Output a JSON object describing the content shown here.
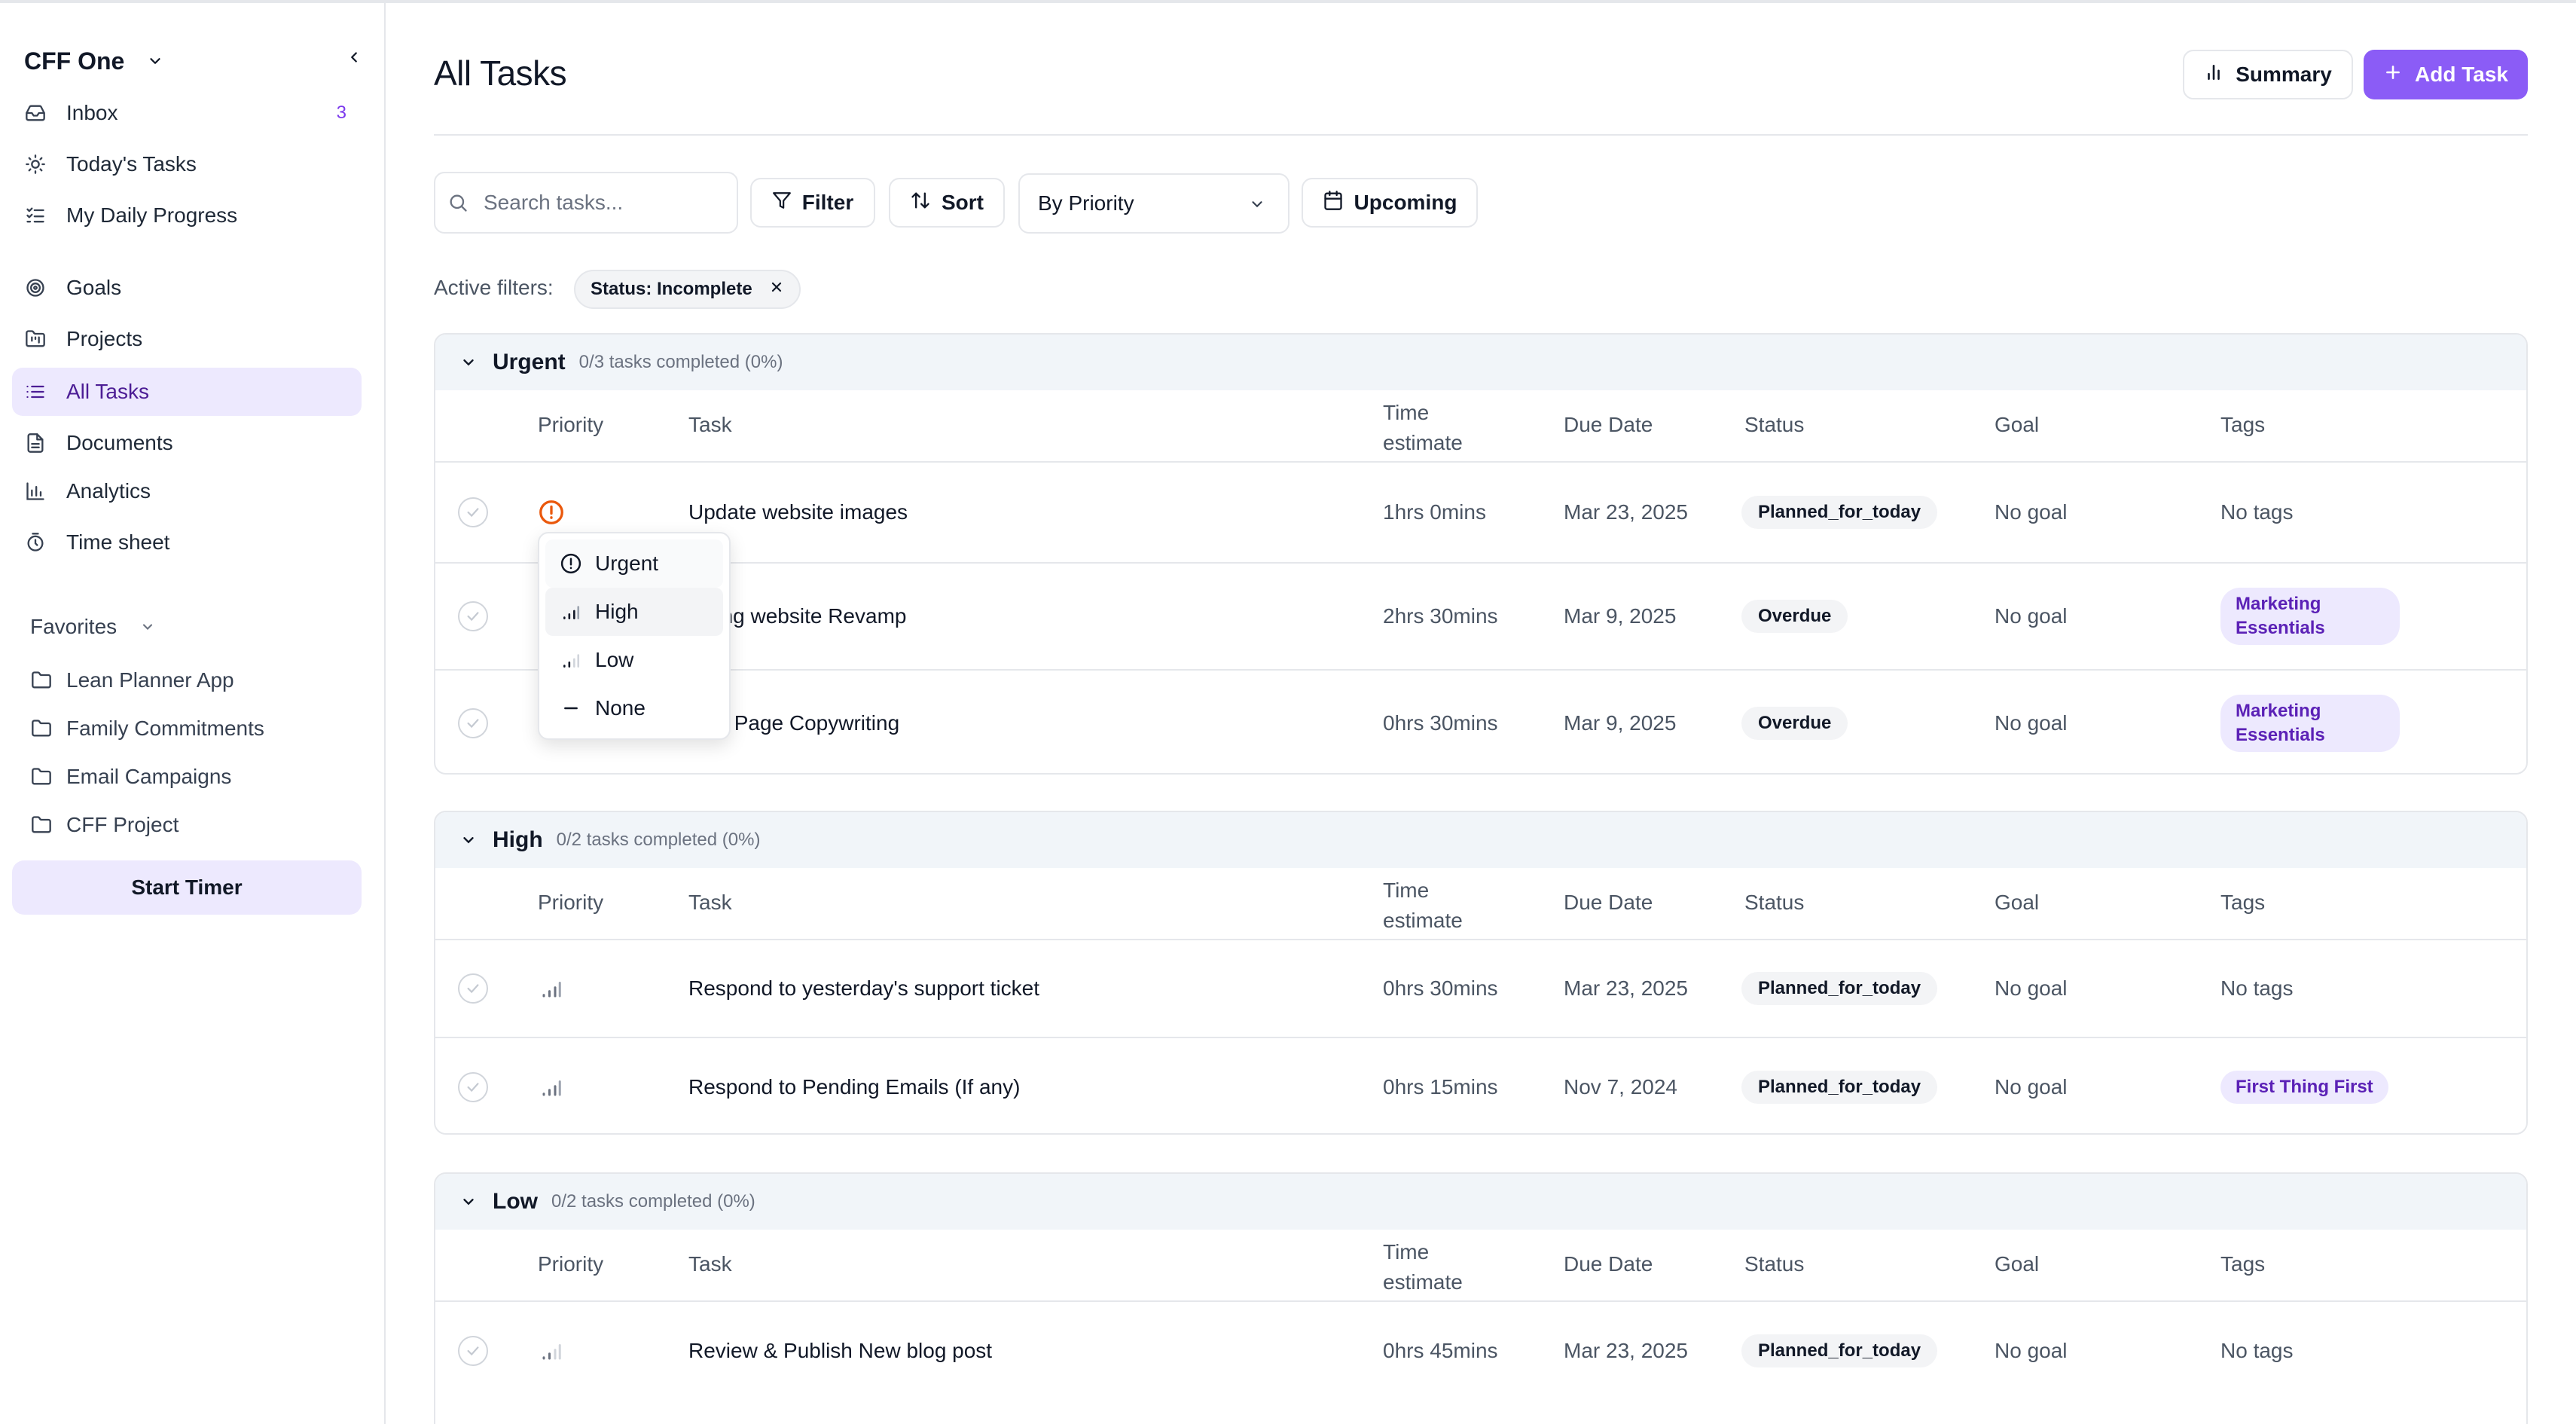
{
  "sidebar": {
    "workspace": "CFF One",
    "nav": [
      {
        "label": "Inbox",
        "icon": "inbox-icon",
        "count": "3"
      },
      {
        "label": "Today's Tasks",
        "icon": "sun-icon"
      },
      {
        "label": "My Daily Progress",
        "icon": "list-check-icon"
      },
      {
        "label": "Goals",
        "icon": "target-icon"
      },
      {
        "label": "Projects",
        "icon": "folder-kanban-icon"
      },
      {
        "label": "All Tasks",
        "icon": "list-icon",
        "active": true
      },
      {
        "label": "Documents",
        "icon": "document-icon"
      },
      {
        "label": "Analytics",
        "icon": "bar-chart-icon"
      },
      {
        "label": "Time sheet",
        "icon": "timer-icon"
      }
    ],
    "favorites_label": "Favorites",
    "favorites": [
      {
        "label": "Lean Planner App"
      },
      {
        "label": "Family Commitments"
      },
      {
        "label": "Email Campaigns"
      },
      {
        "label": "CFF Project"
      }
    ],
    "start_timer": "Start Timer"
  },
  "header": {
    "title": "All Tasks",
    "summary_label": "Summary",
    "add_task_label": "Add Task"
  },
  "toolbar": {
    "search_placeholder": "Search tasks...",
    "filter_label": "Filter",
    "sort_label": "Sort",
    "group_by": "By Priority",
    "upcoming_label": "Upcoming",
    "active_filters_label": "Active filters:",
    "active_filter_chip": "Status: Incomplete"
  },
  "columns": {
    "priority": "Priority",
    "task": "Task",
    "time_estimate": "Time estimate",
    "due_date": "Due Date",
    "status": "Status",
    "goal": "Goal",
    "tags": "Tags"
  },
  "groups": [
    {
      "name": "Urgent",
      "progress": "0/3 tasks completed (0%)",
      "tasks": [
        {
          "task": "Update website images",
          "time": "1hrs 0mins",
          "due": "Mar 23, 2025",
          "status": "Planned_for_today",
          "goal": "No goal",
          "tags": "No tags",
          "priority_icon": "urgent-icon"
        },
        {
          "task": "keting website Revamp",
          "time": "2hrs 30mins",
          "due": "Mar 9, 2025",
          "status": "Overdue",
          "goal": "No goal",
          "tags": "Marketing Essentials",
          "priority_icon": "urgent-icon"
        },
        {
          "task": "ding Page Copywriting",
          "time": "0hrs 30mins",
          "due": "Mar 9, 2025",
          "status": "Overdue",
          "goal": "No goal",
          "tags": "Marketing Essentials",
          "priority_icon": "urgent-icon"
        }
      ]
    },
    {
      "name": "High",
      "progress": "0/2 tasks completed (0%)",
      "tasks": [
        {
          "task": "Respond to yesterday's support ticket",
          "time": "0hrs 30mins",
          "due": "Mar 23, 2025",
          "status": "Planned_for_today",
          "goal": "No goal",
          "tags": "No tags",
          "priority_icon": "signal-high-icon"
        },
        {
          "task": "Respond to Pending Emails (If any)",
          "time": "0hrs 15mins",
          "due": "Nov 7, 2024",
          "status": "Planned_for_today",
          "goal": "No goal",
          "tags": "First Thing First",
          "priority_icon": "signal-high-icon"
        }
      ]
    },
    {
      "name": "Low",
      "progress": "0/2 tasks completed (0%)",
      "tasks": [
        {
          "task": "Review & Publish New blog post",
          "time": "0hrs 45mins",
          "due": "Mar 23, 2025",
          "status": "Planned_for_today",
          "goal": "No goal",
          "tags": "No tags",
          "priority_icon": "signal-low-icon"
        }
      ]
    }
  ],
  "priority_menu": {
    "options": [
      {
        "label": "Urgent",
        "icon": "alert-circle-icon"
      },
      {
        "label": "High",
        "icon": "signal-high-icon"
      },
      {
        "label": "Low",
        "icon": "signal-low-icon"
      },
      {
        "label": "None",
        "icon": "minus-icon"
      }
    ],
    "highlighted": "High"
  },
  "colors": {
    "accent": "#8b5cf6",
    "accent_soft": "#ede9fe",
    "urgent": "#ea580c",
    "tag_text": "#5b21b6"
  }
}
